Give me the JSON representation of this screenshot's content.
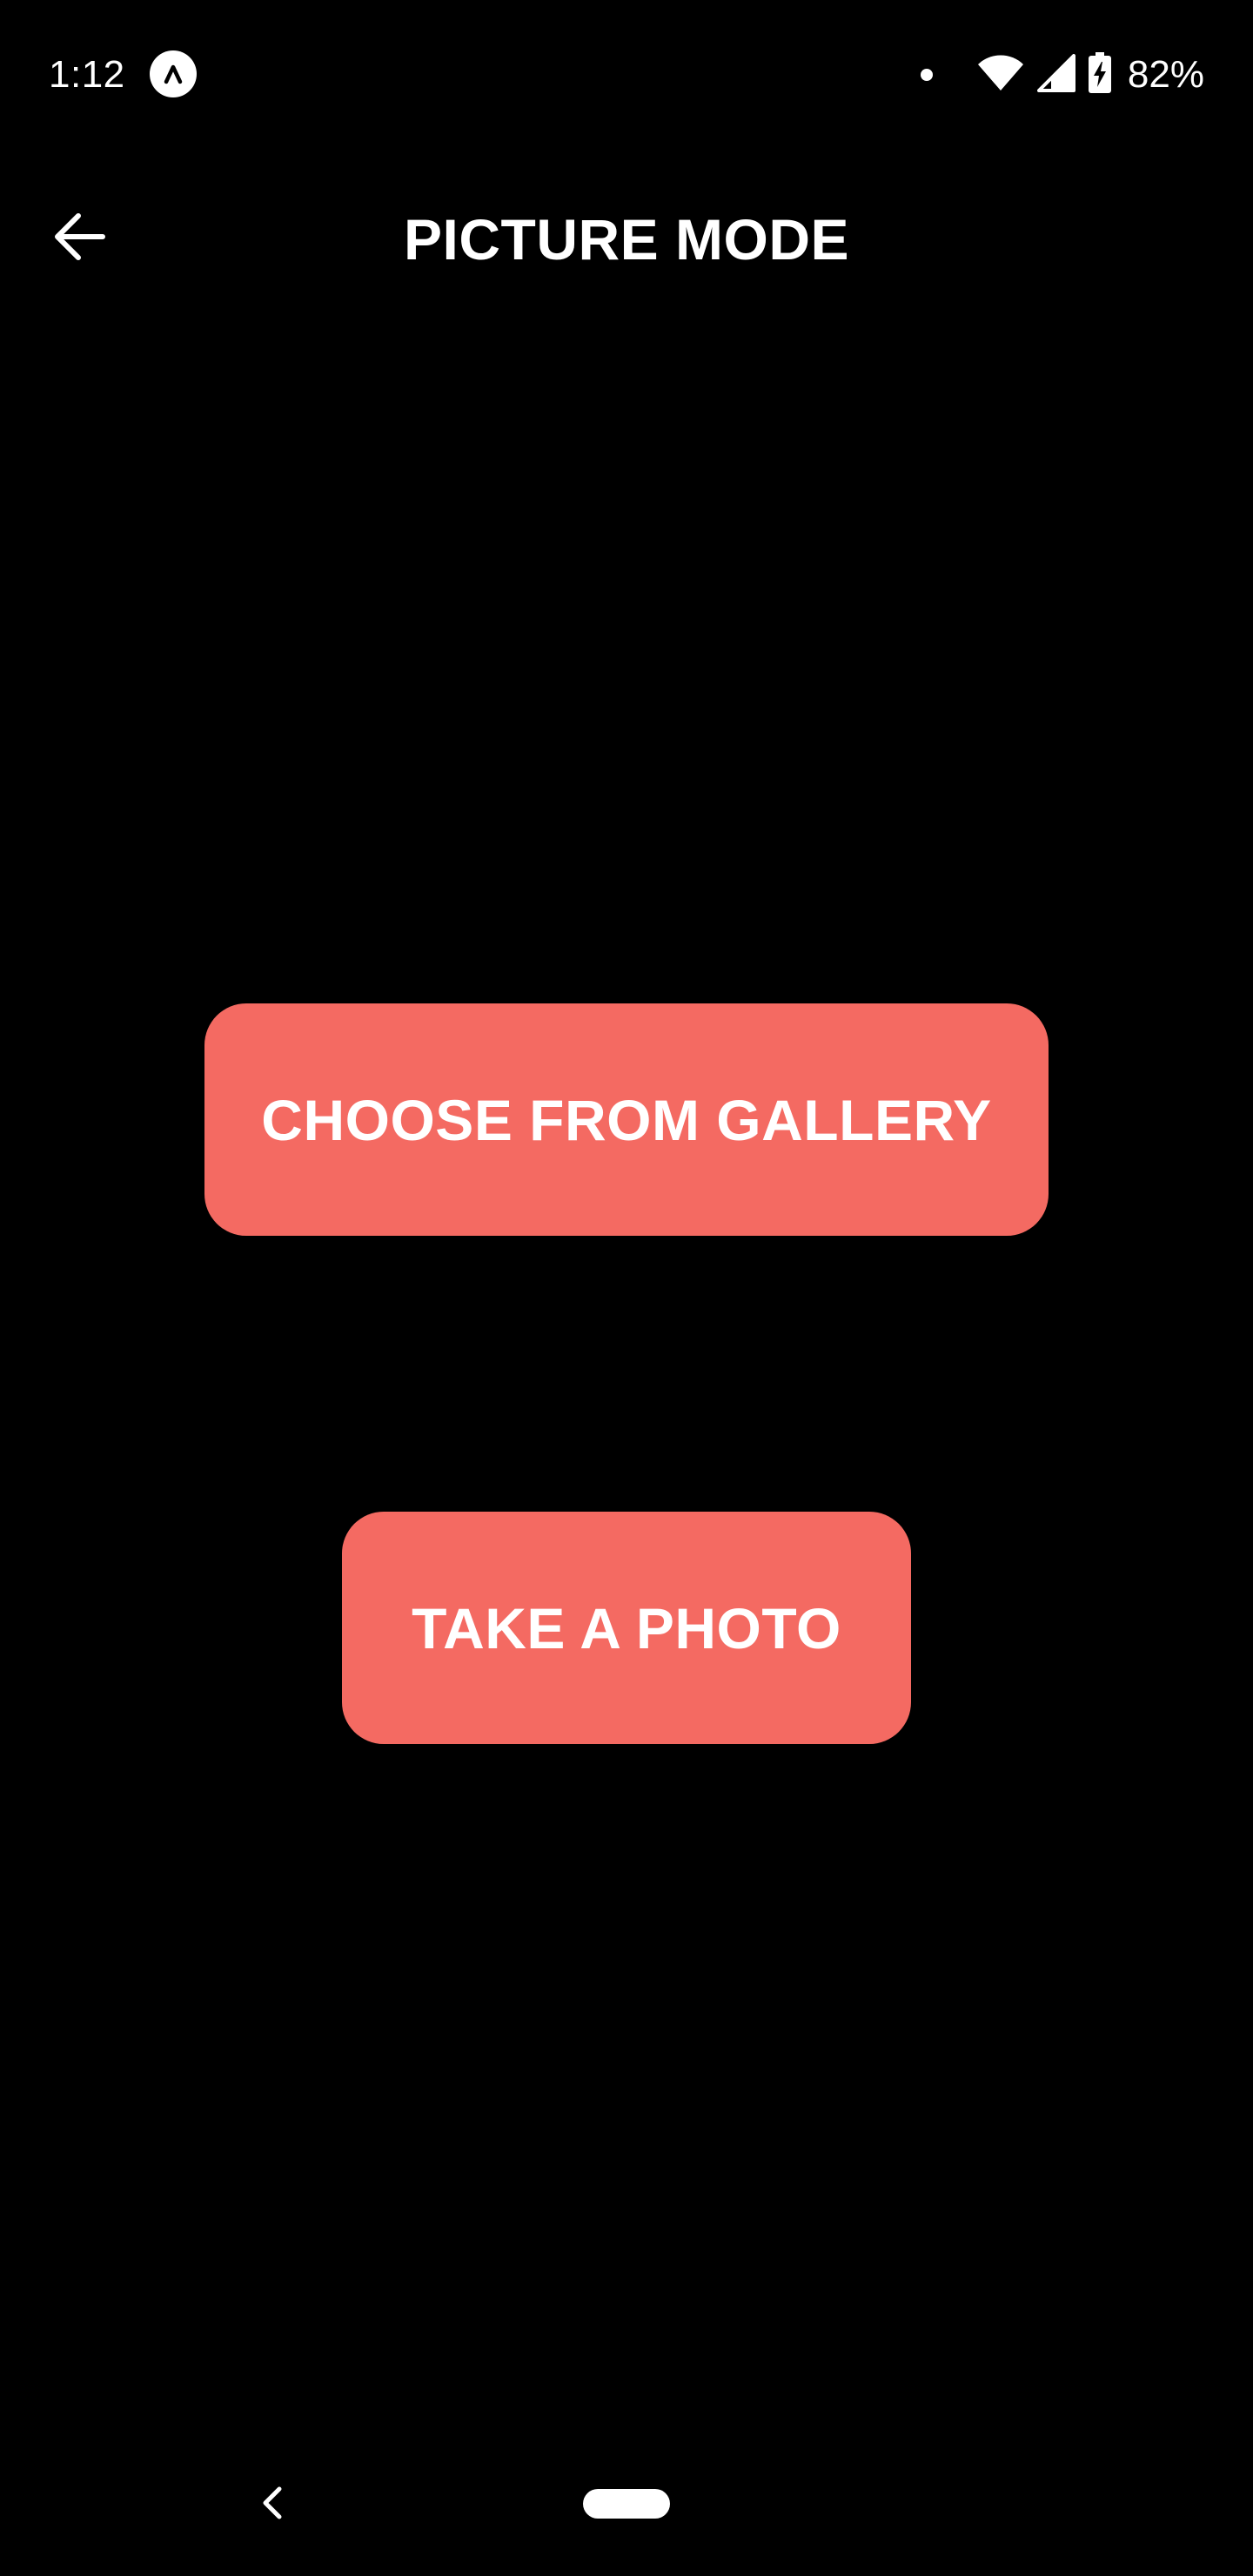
{
  "status_bar": {
    "time": "1:12",
    "app_badge_icon": "expo-a-icon",
    "wifi_icon": "wifi-icon",
    "signal_icon": "cell-signal-icon",
    "battery_icon": "battery-charging-icon",
    "battery_percent": "82%"
  },
  "top_bar": {
    "back_icon": "arrow-left-icon",
    "title": "PICTURE MODE"
  },
  "actions": {
    "gallery_label": "CHOOSE FROM GALLERY",
    "photo_label": "TAKE A PHOTO"
  },
  "nav_bar": {
    "back_icon": "chevron-left-icon",
    "home_icon": "home-pill-icon"
  },
  "colors": {
    "background": "#000000",
    "accent": "#f46a62",
    "text": "#ffffff"
  }
}
